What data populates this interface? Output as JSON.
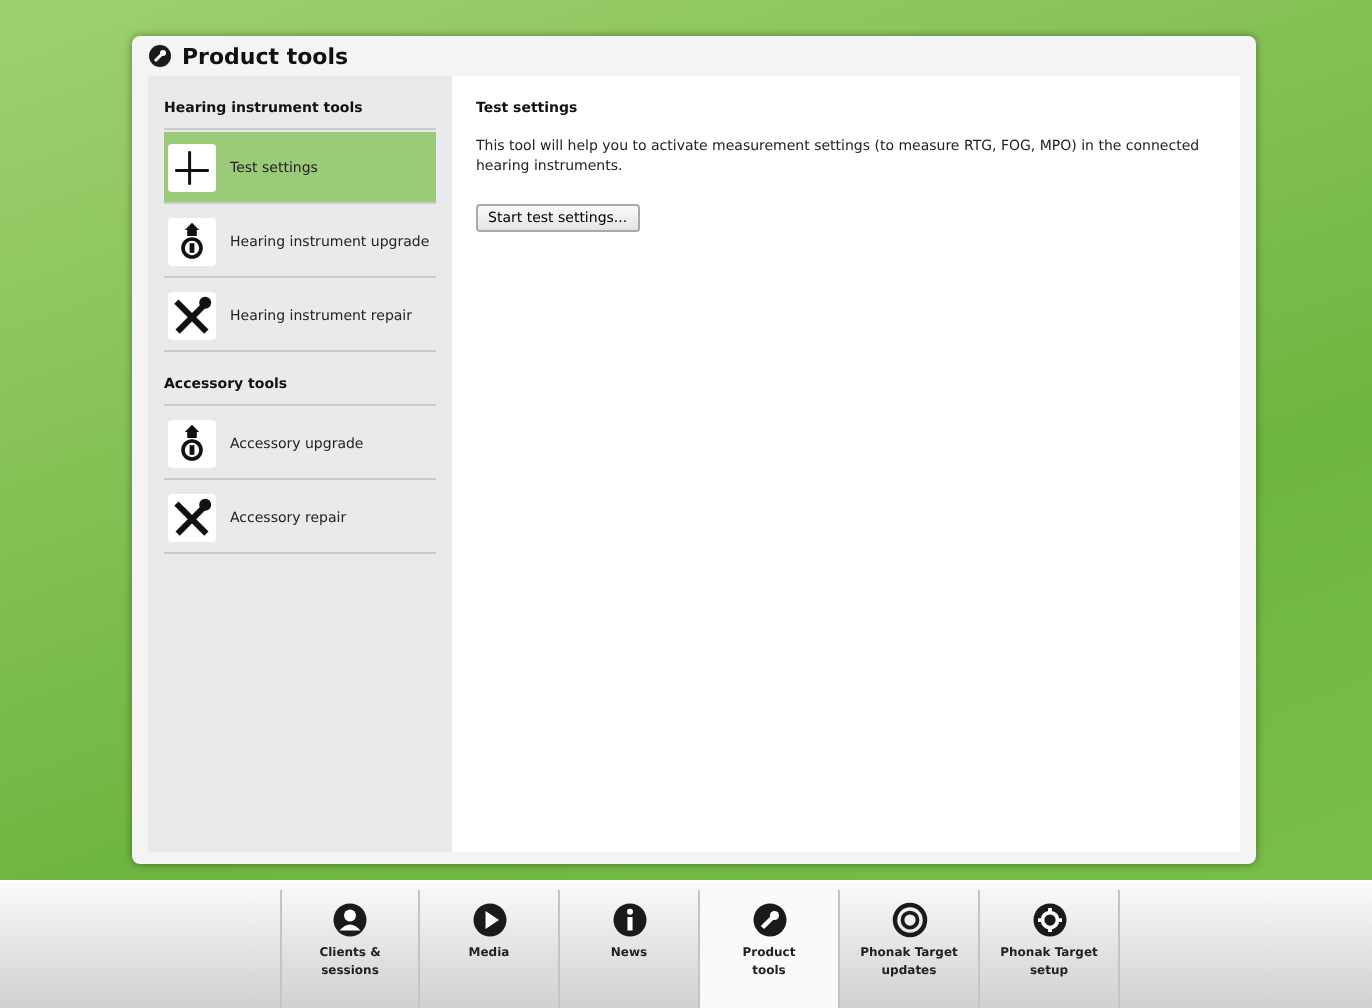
{
  "window": {
    "title": "Product tools"
  },
  "sidebar": {
    "groups": [
      {
        "title": "Hearing instrument tools",
        "items": [
          {
            "label": "Test settings",
            "kind": "test",
            "selected": true
          },
          {
            "label": "Hearing instrument upgrade",
            "kind": "upgrade",
            "selected": false
          },
          {
            "label": "Hearing instrument repair",
            "kind": "repair",
            "selected": false
          }
        ]
      },
      {
        "title": "Accessory tools",
        "items": [
          {
            "label": "Accessory upgrade",
            "kind": "upgrade",
            "selected": false
          },
          {
            "label": "Accessory repair",
            "kind": "repair",
            "selected": false
          }
        ]
      }
    ]
  },
  "content": {
    "title": "Test settings",
    "description": "This tool will help you to activate measurement settings (to measure RTG, FOG, MPO) in the connected hearing instruments.",
    "button": "Start test settings..."
  },
  "nav": [
    {
      "label": "Clients &\nsessions",
      "kind": "person",
      "selected": false
    },
    {
      "label": "Media",
      "kind": "play",
      "selected": false
    },
    {
      "label": "News",
      "kind": "info",
      "selected": false
    },
    {
      "label": "Product\ntools",
      "kind": "wrench",
      "selected": true
    },
    {
      "label": "Phonak Target\nupdates",
      "kind": "refresh",
      "selected": false
    },
    {
      "label": "Phonak Target\nsetup",
      "kind": "gear",
      "selected": false
    }
  ]
}
